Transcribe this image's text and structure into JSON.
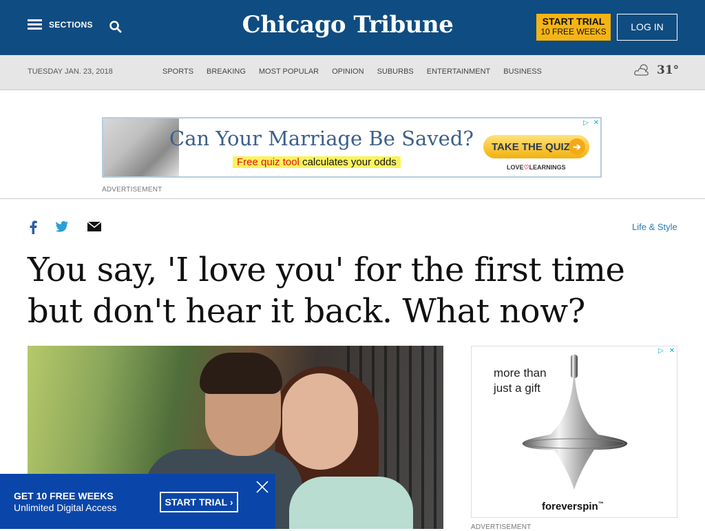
{
  "header": {
    "sections_label": "SECTIONS",
    "logo_text": "Chicago Tribune",
    "start_trial_line1": "START TRIAL",
    "start_trial_line2": "10 FREE WEEKS",
    "login_label": "LOG IN"
  },
  "navbar": {
    "date": "TUESDAY JAN. 23, 2018",
    "links": [
      "SPORTS",
      "BREAKING",
      "MOST POPULAR",
      "OPINION",
      "SUBURBS",
      "ENTERTAINMENT",
      "BUSINESS"
    ],
    "temperature": "31°",
    "weather_icon": "partly-cloudy-icon"
  },
  "ad_top": {
    "headline": "Can Your Marriage Be Saved?",
    "sub_red": "Free quiz tool",
    "sub_black": "calculates your odds",
    "button": "TAKE THE QUIZ",
    "brand_left": "LOVE",
    "brand_right": "LEARNINGS",
    "label": "ADVERTISEMENT"
  },
  "article": {
    "section": "Life & Style",
    "headline": "You say, 'I love you' for the first time but don't hear it back. What now?"
  },
  "ad_right": {
    "line1": "more than",
    "line2": "just a gift",
    "brand": "foreverspin",
    "tm": "™",
    "label": "ADVERTISEMENT"
  },
  "promo": {
    "line1": "GET 10 FREE WEEKS",
    "line2": "Unlimited Digital Access",
    "button": "START TRIAL ›"
  },
  "colors": {
    "header_bg": "#0f4c81",
    "trial_button": "#f6b413",
    "promo_bg": "#0a46a9",
    "section_link": "#2a7ab8"
  }
}
